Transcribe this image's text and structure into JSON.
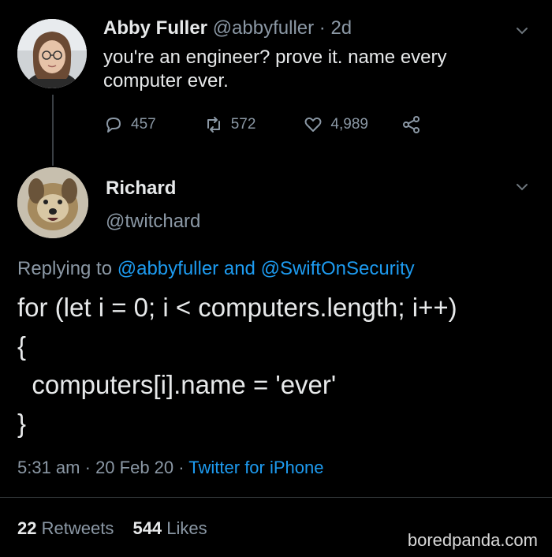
{
  "tweet1": {
    "name": "Abby Fuller",
    "handle": "@abbyfuller",
    "time": "· 2d",
    "text_line1": "you're an engineer? prove it. name every",
    "text_line2": "computer ever.",
    "replies": "457",
    "retweets": "572",
    "likes": "4,989",
    "icons": {
      "reply": "reply-icon",
      "retweet": "retweet-icon",
      "like": "heart-icon",
      "share": "share-icon",
      "menu": "chevron-down-icon"
    }
  },
  "tweet2": {
    "name": "Richard",
    "handle": "@twitchard",
    "replying_prefix": "Replying to",
    "reply_mention1": "@abbyfuller",
    "reply_and": "and",
    "reply_mention2": "@SwiftOnSecurity",
    "code_lines": [
      "for (let i = 0; i < computers.length; i++)",
      "{",
      "  computers[i].name = 'ever'",
      "}"
    ],
    "time": "5:31 am",
    "date": "· 20 Feb 20 ·",
    "source": "Twitter for iPhone",
    "retweet_count": "22",
    "retweet_label": "Retweets",
    "like_count": "544",
    "like_label": "Likes"
  },
  "watermark": "boredpanda.com",
  "colors": {
    "background": "#000000",
    "text": "#e7e9ea",
    "muted": "#8b98a5",
    "accent": "#1d9bf0"
  }
}
